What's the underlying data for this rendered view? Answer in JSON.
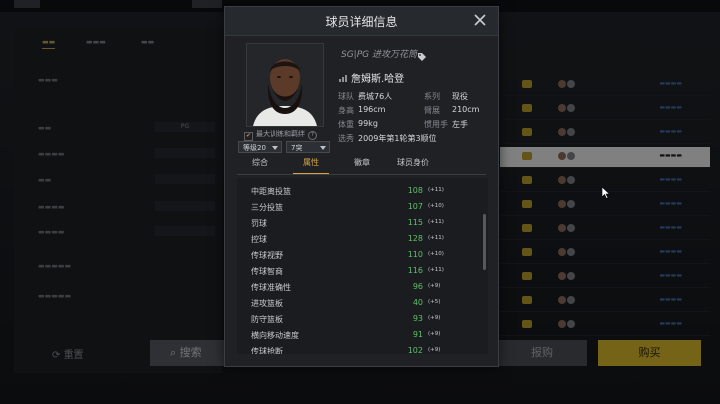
{
  "modal": {
    "title": "球员详细信息",
    "player": {
      "position_tag": "SG|PG 进攻万花筒",
      "name": "詹姆斯.哈登",
      "info": [
        {
          "label": "球队",
          "value": "费城76人"
        },
        {
          "label": "系列",
          "value": "现役"
        },
        {
          "label": "身高",
          "value": "196cm"
        },
        {
          "label": "臂展",
          "value": "210cm"
        },
        {
          "label": "体重",
          "value": "99kg"
        },
        {
          "label": "惯用手",
          "value": "左手"
        },
        {
          "label": "选秀",
          "value": "2009年第1轮第3顺位"
        }
      ],
      "max_train_label": "最大训练和羁绊",
      "level_select": "等级20",
      "breakthrough_select": "7突"
    },
    "tabs": [
      "综合",
      "属性",
      "徽章",
      "球员身价"
    ],
    "active_tab": "属性",
    "attributes": [
      {
        "name": "中距离投篮",
        "value": "108",
        "bonus": "(+11)"
      },
      {
        "name": "三分投篮",
        "value": "107",
        "bonus": "(+10)"
      },
      {
        "name": "罚球",
        "value": "115",
        "bonus": "(+11)"
      },
      {
        "name": "控球",
        "value": "128",
        "bonus": "(+11)"
      },
      {
        "name": "传球视野",
        "value": "110",
        "bonus": "(+10)"
      },
      {
        "name": "传球智商",
        "value": "116",
        "bonus": "(+11)"
      },
      {
        "name": "传球准确性",
        "value": "96",
        "bonus": "(+9)"
      },
      {
        "name": "进攻篮板",
        "value": "40",
        "bonus": "(+5)"
      },
      {
        "name": "防守篮板",
        "value": "93",
        "bonus": "(+9)"
      },
      {
        "name": "横向移动速度",
        "value": "91",
        "bonus": "(+9)"
      },
      {
        "name": "传球抢断",
        "value": "102",
        "bonus": "(+9)"
      }
    ]
  },
  "background": {
    "reset_label": "重置",
    "search_label": "搜索",
    "bid_label": "报购",
    "buy_label": "购买",
    "filter_value": "PG"
  },
  "colors": {
    "accent": "#d8a641",
    "attr_value": "#5fc06a",
    "buy_button": "#d6b42a"
  }
}
